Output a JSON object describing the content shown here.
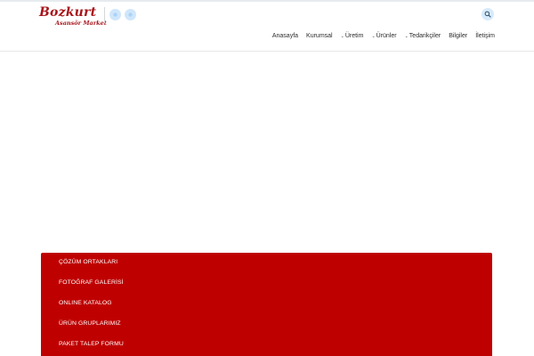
{
  "brand": {
    "name": "Bozkurt",
    "tagline": "Asansör Market",
    "color": "#a8141a"
  },
  "header": {
    "social_icons": [
      "social-icon-1",
      "social-icon-2"
    ],
    "search_icon": "search-icon"
  },
  "nav": {
    "items": [
      {
        "label": "Anasayfa",
        "has_dropdown": false
      },
      {
        "label": "Kurumsal",
        "has_dropdown": false
      },
      {
        "label": "Üretim",
        "has_dropdown": true
      },
      {
        "label": "Ürünler",
        "has_dropdown": true
      },
      {
        "label": "Tedarikçiler",
        "has_dropdown": true
      },
      {
        "label": "Bilgiler",
        "has_dropdown": false
      },
      {
        "label": "İletişim",
        "has_dropdown": false
      }
    ]
  },
  "panel": {
    "color": "#bf0000",
    "items": [
      {
        "label": "ÇÖZÜM ORTAKLARI"
      },
      {
        "label": "FOTOĞRAF GALERİSİ"
      },
      {
        "label": "ONLINE KATALOG"
      },
      {
        "label": "ÜRÜN GRUPLARIMIZ"
      },
      {
        "label": "PAKET TALEP FORMU"
      }
    ]
  }
}
